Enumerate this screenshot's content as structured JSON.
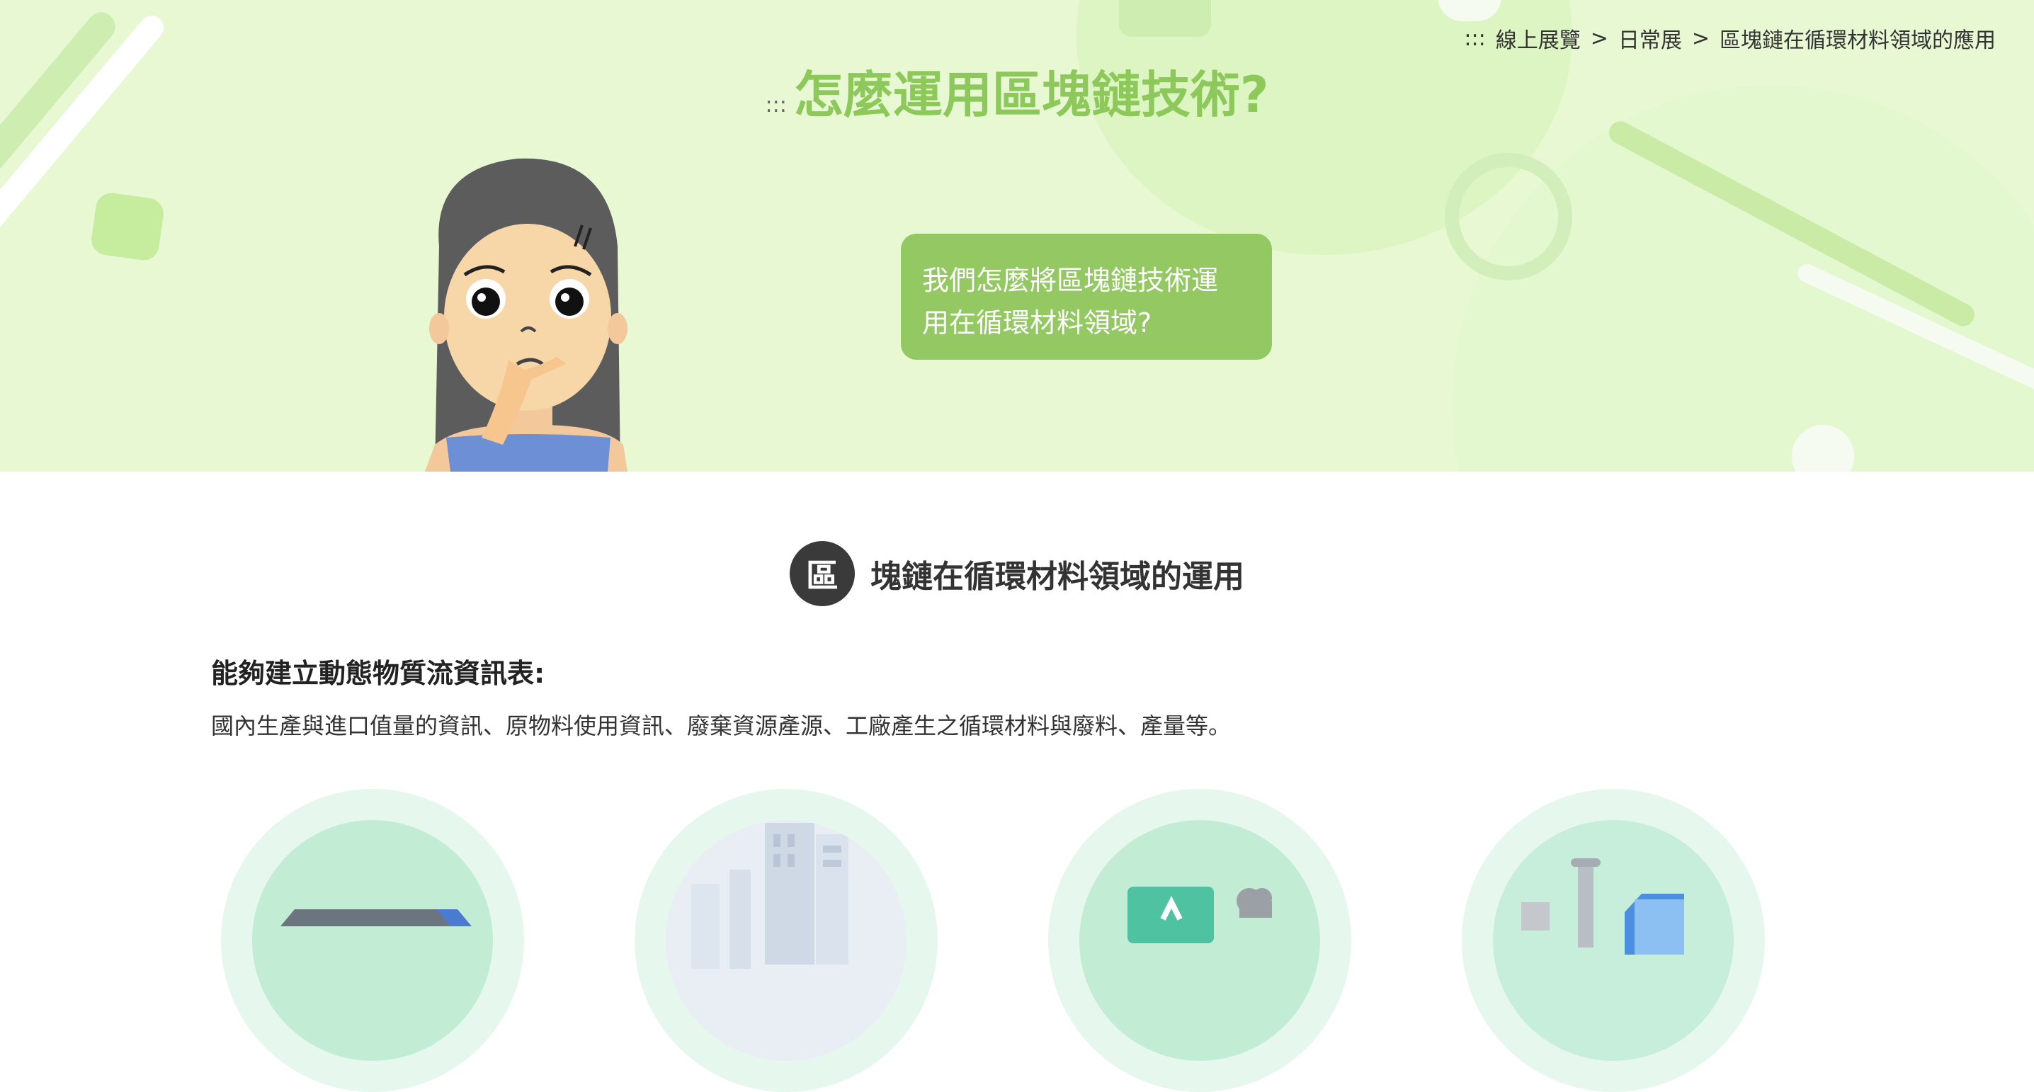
{
  "breadcrumb": {
    "prefix": ":::",
    "items": [
      "線上展覽",
      "日常展",
      "區塊鏈在循環材料領域的應用"
    ],
    "separator": ">"
  },
  "hero": {
    "colons": ":::",
    "title": "怎麼運用區塊鏈技術?",
    "bubble_line1": "我們怎麼將區塊鏈技術運",
    "bubble_line2": "用在循環材料領域?"
  },
  "section": {
    "badge": "區",
    "title": "塊鏈在循環材料領域的運用"
  },
  "content": {
    "subtitle": "能夠建立動態物質流資訊表:",
    "text": "國內生產與進口值量的資訊、原物料使用資訊、廢棄資源產源、工廠產生之循環材料與廢料、產量等。"
  },
  "icons": [
    "warehouse-illustration",
    "city-buildings-illustration",
    "recycling-data-illustration",
    "lab-materials-illustration"
  ],
  "colors": {
    "hero_bg": "#e7f8d3",
    "title_green": "#8dc85a",
    "bubble_green": "#93c862",
    "badge_dark": "#3a3a3a",
    "circle_mint": "#c3ecd4"
  }
}
